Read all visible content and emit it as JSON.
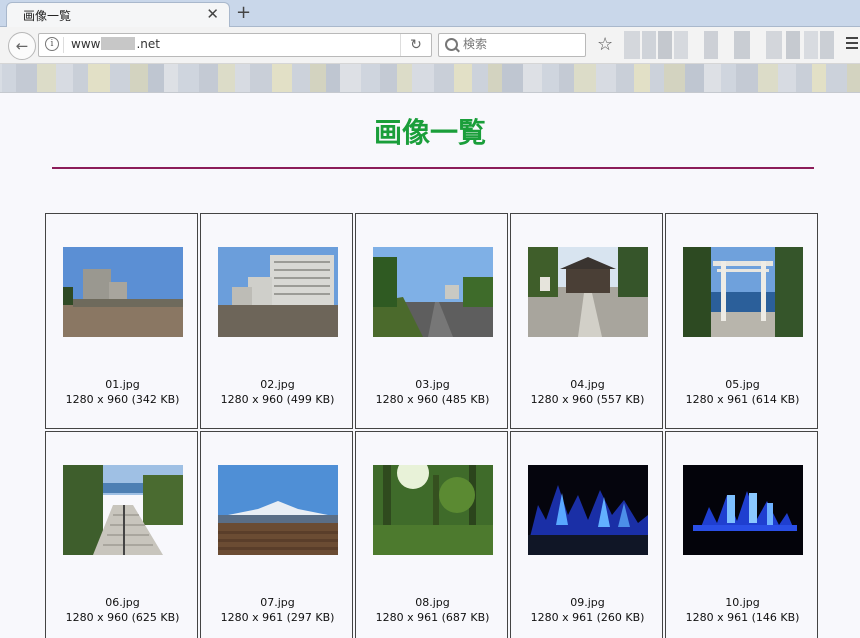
{
  "tab": {
    "title": "画像一覧",
    "close_icon": "close-icon",
    "new_tab_icon": "plus-icon"
  },
  "nav": {
    "url_prefix": "www",
    "url_suffix": ".net",
    "search_placeholder": "検索"
  },
  "page": {
    "title": "画像一覧"
  },
  "images": [
    {
      "name": "01.jpg",
      "info": "1280 x 960 (342 KB)"
    },
    {
      "name": "02.jpg",
      "info": "1280 x 960 (499 KB)"
    },
    {
      "name": "03.jpg",
      "info": "1280 x 960 (485 KB)"
    },
    {
      "name": "04.jpg",
      "info": "1280 x 960 (557 KB)"
    },
    {
      "name": "05.jpg",
      "info": "1280 x 961 (614 KB)"
    },
    {
      "name": "06.jpg",
      "info": "1280 x 960 (625 KB)"
    },
    {
      "name": "07.jpg",
      "info": "1280 x 961 (297 KB)"
    },
    {
      "name": "08.jpg",
      "info": "1280 x 961 (687 KB)"
    },
    {
      "name": "09.jpg",
      "info": "1280 x 961 (260 KB)"
    },
    {
      "name": "10.jpg",
      "info": "1280 x 961 (146 KB)"
    }
  ],
  "colors": {
    "title_green": "#1a9e3a",
    "rule": "#8c1d5a"
  }
}
